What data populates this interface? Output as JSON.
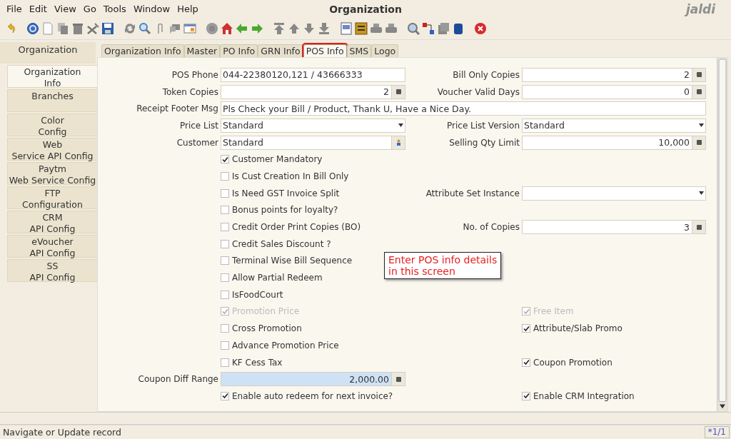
{
  "menu": [
    {
      "label": "File"
    },
    {
      "label": "Edit"
    },
    {
      "label": "View"
    },
    {
      "label": "Go"
    },
    {
      "label": "Tools"
    },
    {
      "label": "Window"
    },
    {
      "label": "Help"
    }
  ],
  "window": {
    "title": "Organization",
    "logo": "jaldi"
  },
  "sidebar": {
    "header": "Organization",
    "items": [
      {
        "label": "Organization\nInfo",
        "selected": true
      },
      {
        "label": "Branches",
        "selected": false
      },
      {
        "label": "Color\nConfig",
        "selected": false
      },
      {
        "label": "Web\nService API Config",
        "selected": false
      },
      {
        "label": "Paytm\nWeb Service Config",
        "selected": false
      },
      {
        "label": "FTP\nConfiguration",
        "selected": false
      },
      {
        "label": "CRM\nAPI Config",
        "selected": false
      },
      {
        "label": "eVoucher\nAPI Config",
        "selected": false
      },
      {
        "label": "SS\nAPI Config",
        "selected": false
      }
    ]
  },
  "tabs": [
    {
      "label": "Organization Info",
      "selected": false,
      "highlighted": false
    },
    {
      "label": "Master",
      "selected": false,
      "highlighted": false
    },
    {
      "label": "PO Info",
      "selected": false,
      "highlighted": false
    },
    {
      "label": "GRN Info",
      "selected": false,
      "highlighted": false
    },
    {
      "label": "POS Info",
      "selected": true,
      "highlighted": true
    },
    {
      "label": "SMS",
      "selected": false,
      "highlighted": false
    },
    {
      "label": "Logo",
      "selected": false,
      "highlighted": false
    }
  ],
  "form": {
    "rows": [
      {
        "left": {
          "kind": "text",
          "label": "POS Phone",
          "value": "044-22380120,121 / 43666333"
        },
        "right": {
          "kind": "number",
          "label": "Bill Only Copies",
          "value": "2"
        }
      },
      {
        "left": {
          "kind": "number",
          "label": "Token Copies",
          "value": "2"
        },
        "right": {
          "kind": "number",
          "label": "Voucher Valid Days",
          "value": "0"
        }
      },
      {
        "wide": {
          "kind": "text",
          "label": "Receipt Footer Msg",
          "value": "Pls Check your Bill / Product, Thank U, Have a Nice Day."
        }
      },
      {
        "left": {
          "kind": "select",
          "label": "Price List",
          "value": "Standard"
        },
        "right": {
          "kind": "select",
          "label": "Price List Version",
          "value": "Standard"
        }
      },
      {
        "left": {
          "kind": "lookup",
          "label": "Customer",
          "value": "Standard"
        },
        "right": {
          "kind": "number",
          "label": "Selling Qty Limit",
          "value": "10,000"
        }
      },
      {
        "left": {
          "kind": "checkbox",
          "label": "Customer Mandatory",
          "checked": true,
          "disabled": false
        }
      },
      {
        "left": {
          "kind": "checkbox",
          "label": "Is Cust Creation In Bill Only",
          "checked": false,
          "disabled": false
        }
      },
      {
        "left": {
          "kind": "checkbox",
          "label": "Is Need GST Invoice Split",
          "checked": false,
          "disabled": false
        },
        "right": {
          "kind": "select",
          "label": "Attribute Set Instance"
        }
      },
      {
        "left": {
          "kind": "checkbox",
          "label": "Bonus points for loyalty?",
          "checked": false,
          "disabled": false
        }
      },
      {
        "left": {
          "kind": "checkbox",
          "label": "Credit Order Print Copies (BO)",
          "checked": false,
          "disabled": false
        },
        "right": {
          "kind": "number",
          "label": "No. of Copies",
          "value": "3"
        }
      },
      {
        "left": {
          "kind": "checkbox",
          "label": "Credit Sales Discount ?",
          "checked": false,
          "disabled": false
        }
      },
      {
        "left": {
          "kind": "checkbox",
          "label": "Terminal Wise Bill Sequence",
          "checked": false,
          "disabled": false
        }
      },
      {
        "left": {
          "kind": "checkbox",
          "label": "Allow Partial Redeem",
          "checked": false,
          "disabled": false
        }
      },
      {
        "left": {
          "kind": "checkbox",
          "label": "IsFoodCourt",
          "checked": false,
          "disabled": false
        }
      },
      {
        "left": {
          "kind": "checkbox",
          "label": "Promotion Price",
          "checked": true,
          "disabled": true
        },
        "right": {
          "kind": "checkbox",
          "label": "Free Item",
          "checked": true,
          "disabled": true
        }
      },
      {
        "left": {
          "kind": "checkbox",
          "label": "Cross Promotion",
          "checked": false,
          "disabled": false
        },
        "right": {
          "kind": "checkbox",
          "label": "Attribute/Slab Promo",
          "checked": true,
          "disabled": false
        }
      },
      {
        "left": {
          "kind": "checkbox",
          "label": "Advance Promotion Price",
          "checked": false,
          "disabled": false
        }
      },
      {
        "left": {
          "kind": "checkbox",
          "label": "KF Cess Tax",
          "checked": false,
          "disabled": false
        },
        "right": {
          "kind": "checkbox",
          "label": "Coupon Promotion",
          "checked": true,
          "disabled": false
        }
      },
      {
        "left": {
          "kind": "number",
          "label": "Coupon Diff Range",
          "value": "2,000.00",
          "focused": true
        }
      },
      {
        "left": {
          "kind": "checkbox",
          "label": "Enable auto redeem for next invoice?",
          "checked": true,
          "disabled": false
        },
        "right": {
          "kind": "checkbox",
          "label": "Enable CRM Integration",
          "checked": true,
          "disabled": false
        }
      }
    ],
    "callout": "Enter POS info details\nin this screen"
  },
  "status_bar": {
    "message": "Navigate or Update record",
    "record": "*1/1"
  }
}
